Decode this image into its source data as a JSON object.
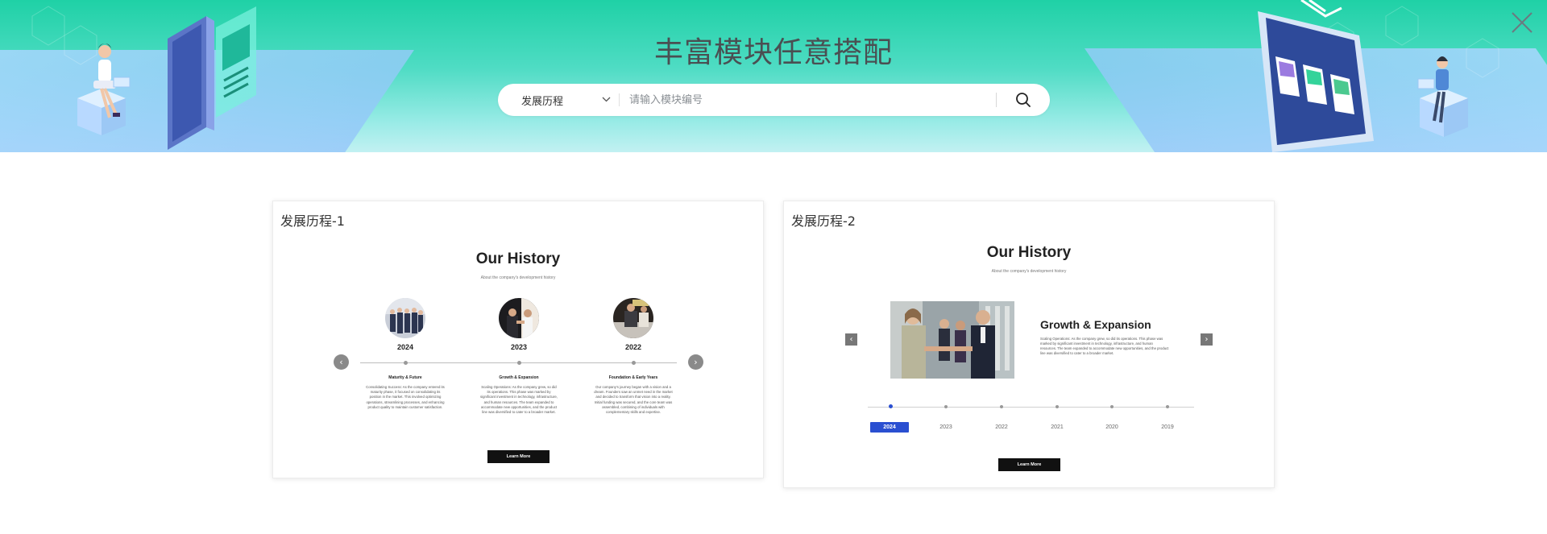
{
  "banner": {
    "title": "丰富模块任意搭配"
  },
  "search": {
    "category_selected": "发展历程",
    "placeholder": "请输入模块编号",
    "search_icon": "search-icon"
  },
  "close_icon": "close-icon",
  "cards": [
    {
      "label": "发展历程-1",
      "title": "Our History",
      "subtitle": "About the company's development history",
      "years": [
        "2024",
        "2023",
        "2022"
      ],
      "columns": [
        {
          "title": "Maturity & Future",
          "desc": "Consolidating Success: As the company entered its maturity phase, it focused on consolidating its position in the market. This involved optimizing operations, streamlining processes, and enhancing product quality to maintain customer satisfaction."
        },
        {
          "title": "Growth & Expansion",
          "desc": "Scaling Operations: As the company grew, so did its operations. This phase was marked by significant investment in technology, infrastructure, and human resources. The team expanded to accommodate new opportunities, and the product line was diversified to cater to a broader market."
        },
        {
          "title": "Foundation & Early Years",
          "desc": "Our company's journey began with a vision and a dream. Founders saw an unmet need in the market and decided to transform that vision into a reality. Initial funding was secured, and the core team was assembled, combining of individuals with complementary skills and expertise."
        }
      ],
      "button": "Learn More"
    },
    {
      "label": "发展历程-2",
      "title": "Our History",
      "subtitle": "About the company's development history",
      "heading": "Growth & Expansion",
      "desc": "Scaling Operations: As the company grew, so did its operations. This phase was marked by significant investment in technology, infrastructure, and human resources. The team expanded to accommodate new opportunities, and the product line was diversified to cater to a broader market.",
      "years": [
        "2024",
        "2023",
        "2022",
        "2021",
        "2020",
        "2019"
      ],
      "active_year": "2024",
      "button": "Learn More"
    }
  ],
  "colors": {
    "accent_blue": "#2a4fd1",
    "banner_green": "#1fd1a6",
    "banner_light": "#c2f1f2"
  }
}
